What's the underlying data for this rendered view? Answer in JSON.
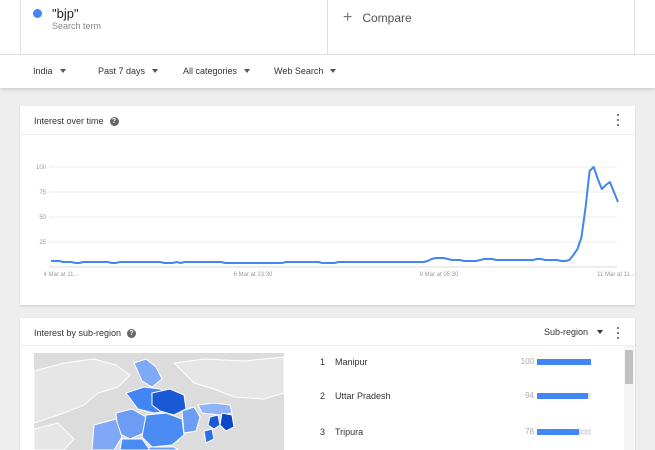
{
  "search_term": {
    "name": "\"bjp\"",
    "subtitle": "Search term",
    "color": "#4285f4"
  },
  "compare": {
    "label": "Compare"
  },
  "filters": {
    "region": "India",
    "time": "Past 7 days",
    "category": "All categories",
    "search_type": "Web Search"
  },
  "interest_over_time": {
    "title": "Interest over time",
    "help_icon": "help-circle-icon",
    "menu_icon": "more-vert-icon"
  },
  "chart_data": {
    "type": "line",
    "yticks": [
      "25",
      "50",
      "75",
      "100"
    ],
    "xtick_labels": [
      "4 Mar at 11...",
      "6 Mar at 23:30",
      "9 Mar at 05:30",
      "11 Mar at 11..."
    ],
    "ylim": [
      0,
      100
    ],
    "grid": true,
    "series": [
      {
        "color": "#4285f4",
        "values": [
          6,
          6,
          6,
          5,
          5,
          5,
          4,
          4,
          5,
          5,
          5,
          5,
          5,
          5,
          5,
          4,
          4,
          5,
          5,
          5,
          5,
          5,
          5,
          5,
          5,
          5,
          5,
          5,
          4,
          4,
          4,
          5,
          4,
          5,
          5,
          5,
          5,
          5,
          5,
          5,
          5,
          5,
          5,
          4,
          4,
          4,
          4,
          4,
          4,
          4,
          4,
          4,
          4,
          4,
          4,
          4,
          4,
          4,
          5,
          5,
          5,
          5,
          5,
          5,
          5,
          5,
          5,
          4,
          4,
          4,
          4,
          5,
          5,
          5,
          5,
          5,
          5,
          5,
          5,
          5,
          5,
          5,
          5,
          5,
          5,
          5,
          5,
          5,
          5,
          5,
          5,
          5,
          5,
          6,
          8,
          9,
          9,
          9,
          8,
          7,
          7,
          7,
          6,
          6,
          6,
          6,
          7,
          8,
          8,
          8,
          7,
          7,
          7,
          7,
          7,
          7,
          7,
          7,
          7,
          7,
          8,
          8,
          7,
          7,
          7,
          7,
          6,
          6,
          7,
          12,
          18,
          30,
          60,
          96,
          100,
          88,
          78,
          82,
          85,
          75,
          65
        ]
      }
    ]
  },
  "interest_by_subregion": {
    "title": "Interest by sub-region",
    "help_icon": "help-circle-icon",
    "menu_icon": "more-vert-icon",
    "resolution_select": "Sub-region",
    "rows": [
      {
        "rank": "1",
        "name": "Manipur",
        "value": "100",
        "level": 100
      },
      {
        "rank": "2",
        "name": "Uttar Pradesh",
        "value": "94",
        "level": 94
      },
      {
        "rank": "3",
        "name": "Tripura",
        "value": "78",
        "level": 78
      }
    ],
    "bar_color": "#4285f4"
  }
}
